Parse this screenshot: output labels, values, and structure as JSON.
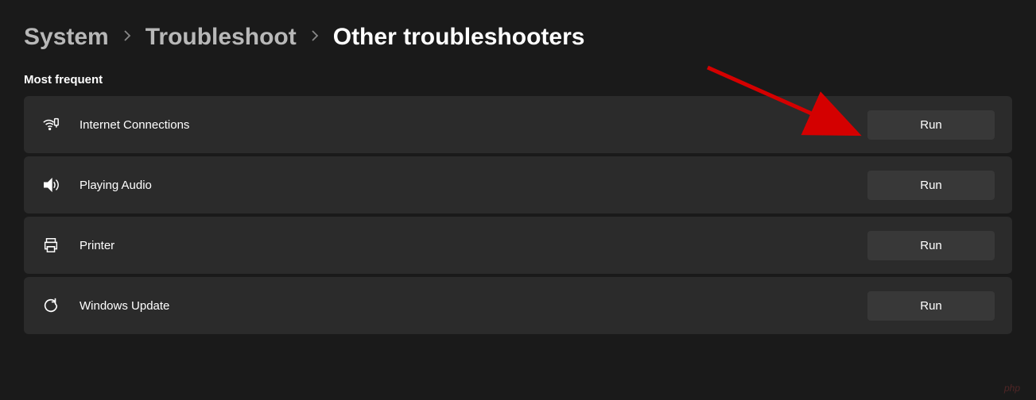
{
  "breadcrumb": {
    "items": [
      "System",
      "Troubleshoot"
    ],
    "current": "Other troubleshooters"
  },
  "section_title": "Most frequent",
  "run_label": "Run",
  "troubleshooters": [
    {
      "label": "Internet Connections",
      "icon": "wifi-icon"
    },
    {
      "label": "Playing Audio",
      "icon": "audio-icon"
    },
    {
      "label": "Printer",
      "icon": "printer-icon"
    },
    {
      "label": "Windows Update",
      "icon": "update-icon"
    }
  ],
  "watermark": "php"
}
